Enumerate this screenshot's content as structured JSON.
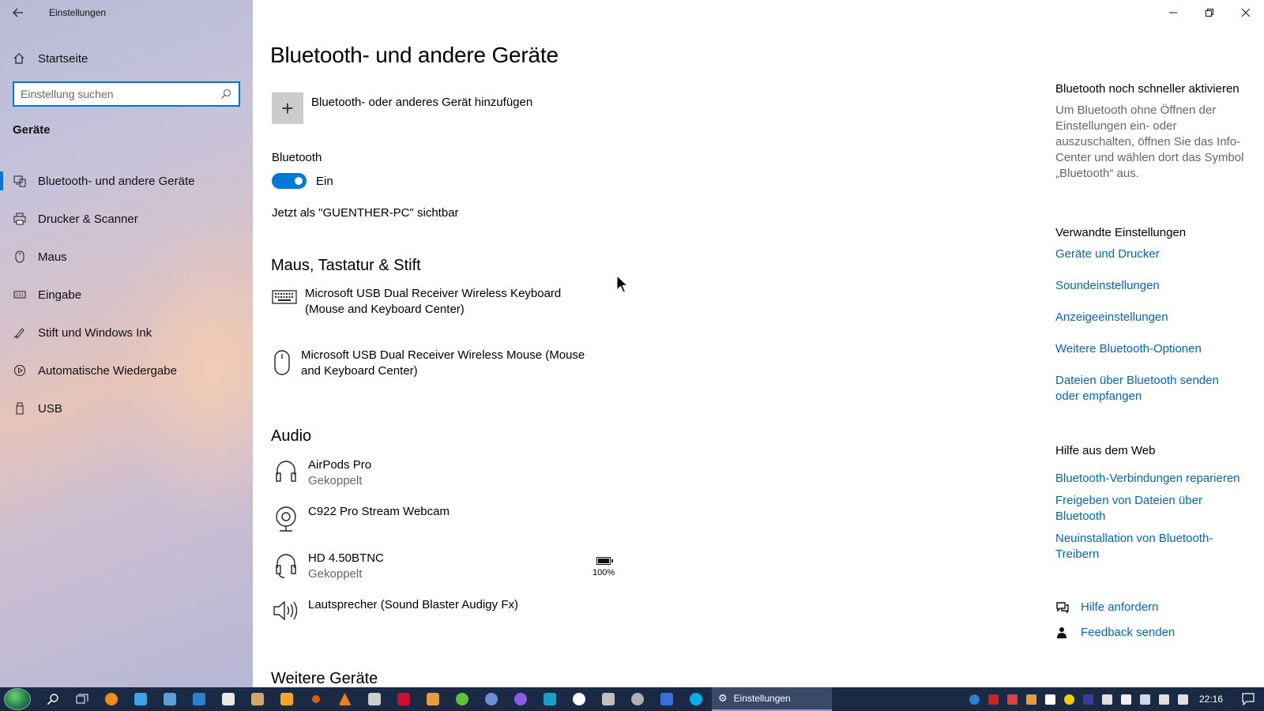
{
  "window": {
    "title": "Einstellungen",
    "back_icon": "arrow-left-icon"
  },
  "sidebar": {
    "home_label": "Startseite",
    "search_placeholder": "Einstellung suchen",
    "section_label": "Geräte",
    "items": [
      {
        "label": "Bluetooth- und andere Geräte",
        "icon": "bluetooth-devices-icon",
        "active": true
      },
      {
        "label": "Drucker & Scanner",
        "icon": "printer-icon",
        "active": false
      },
      {
        "label": "Maus",
        "icon": "mouse-icon",
        "active": false
      },
      {
        "label": "Eingabe",
        "icon": "keyboard-icon",
        "active": false
      },
      {
        "label": "Stift und Windows Ink",
        "icon": "pen-icon",
        "active": false
      },
      {
        "label": "Automatische Wiedergabe",
        "icon": "autoplay-icon",
        "active": false
      },
      {
        "label": "USB",
        "icon": "usb-icon",
        "active": false
      }
    ]
  },
  "main": {
    "title": "Bluetooth- und andere Geräte",
    "add_device_label": "Bluetooth- oder anderes Gerät hinzufügen",
    "bluetooth_label": "Bluetooth",
    "bluetooth_state": "Ein",
    "bluetooth_on": true,
    "visible_as": "Jetzt als \"GUENTHER-PC\" sichtbar",
    "sections": {
      "input_heading": "Maus, Tastatur & Stift",
      "audio_heading": "Audio",
      "other_heading": "Weitere Geräte"
    },
    "input_devices": [
      {
        "name": "Microsoft USB Dual Receiver Wireless Keyboard (Mouse and Keyboard Center)",
        "icon": "keyboard-icon"
      },
      {
        "name": "Microsoft USB Dual Receiver Wireless Mouse (Mouse and Keyboard Center)",
        "icon": "mouse-icon"
      }
    ],
    "audio_devices": [
      {
        "name": "AirPods Pro",
        "status": "Gekoppelt",
        "icon": "headphones-icon"
      },
      {
        "name": "C922 Pro Stream Webcam",
        "status": "",
        "icon": "webcam-icon"
      },
      {
        "name": "HD 4.50BTNC",
        "status": "Gekoppelt",
        "icon": "headset-icon",
        "battery": "100%"
      },
      {
        "name": "Lautsprecher (Sound Blaster Audigy Fx)",
        "status": "",
        "icon": "speaker-icon"
      }
    ]
  },
  "aside": {
    "quick_heading": "Bluetooth noch schneller aktivieren",
    "quick_text": "Um Bluetooth ohne Öffnen der Einstellungen ein- oder auszuschalten, öffnen Sie das Info-Center und wählen dort das Symbol „Bluetooth“ aus.",
    "related_heading": "Verwandte Einstellungen",
    "related_links": [
      "Geräte und Drucker",
      "Soundeinstellungen",
      "Anzeigeeinstellungen",
      "Weitere Bluetooth-Optionen",
      "Dateien über Bluetooth senden oder empfangen"
    ],
    "web_help_heading": "Hilfe aus dem Web",
    "web_links": [
      "Bluetooth-Verbindungen reparieren",
      "Freigeben von Dateien über Bluetooth",
      "Neuinstallation von Bluetooth-Treibern"
    ],
    "get_help": "Hilfe anfordern",
    "feedback": "Feedback senden"
  },
  "taskbar": {
    "active_app": "Einstellungen",
    "clock": "22:16"
  },
  "colors": {
    "accent": "#0078d7",
    "link": "#0067b8",
    "taskbar": "#1a2a44"
  }
}
